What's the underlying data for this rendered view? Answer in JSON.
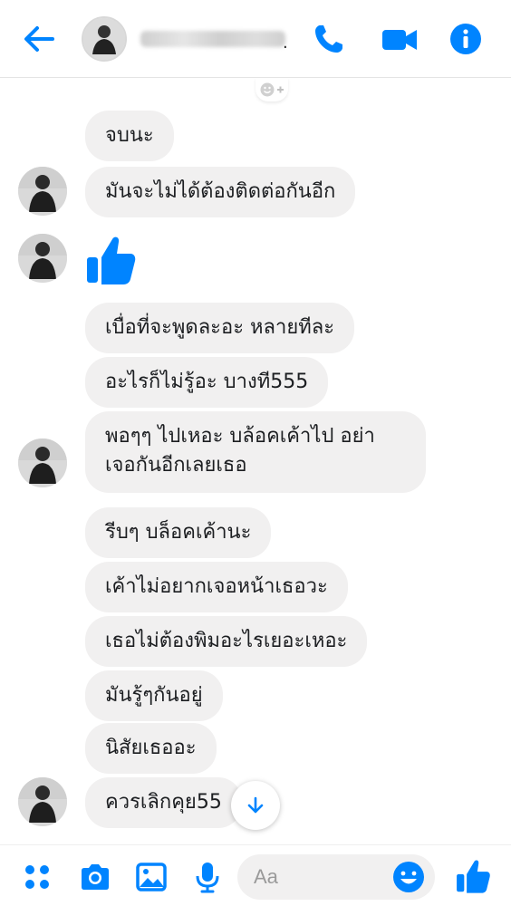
{
  "header": {
    "contact_name_suffix": ".",
    "icons": [
      "back-arrow-icon",
      "phone-icon",
      "video-camera-icon",
      "info-icon"
    ],
    "accent_color": "#0084ff"
  },
  "conversation": {
    "messages": [
      {
        "text": "จบนะ"
      },
      {
        "text": "มันจะไม่ได้ต้องติดต่อกันอีก"
      },
      {
        "type": "like-sticker"
      },
      {
        "text": "เบื่อที่จะพูดละอะ หลายทีละ"
      },
      {
        "text": "อะไรก็ไม่รู้อะ บางที555"
      },
      {
        "text": "พอๆๆ ไปเหอะ บล้อคเค้าไป อย่า เจอกันอีกเลยเธอ"
      },
      {
        "text": "รีบๆ บล็อคเค้านะ"
      },
      {
        "text": "เค้าไม่อยากเจอหน้าเธอวะ"
      },
      {
        "text": "เธอไม่ต้องพิมอะไรเยอะเหอะ"
      },
      {
        "text": "มันรู้ๆกันอยู่"
      },
      {
        "text": "นิสัยเธออะ"
      },
      {
        "text": "ควรเลิกคุย55"
      }
    ],
    "bubble_color": "#f1f0f0"
  },
  "composer": {
    "placeholder": "Aa",
    "icons": [
      "apps-grid-icon",
      "camera-icon",
      "image-icon",
      "microphone-icon",
      "emoji-icon",
      "like-icon"
    ]
  }
}
